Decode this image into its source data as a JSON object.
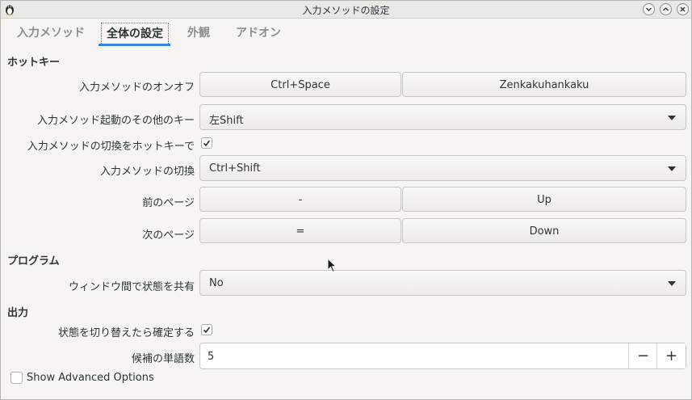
{
  "window": {
    "title": "入力メソッドの設定"
  },
  "tabs": [
    {
      "label": "入力メソッド"
    },
    {
      "label": "全体の設定"
    },
    {
      "label": "外観"
    },
    {
      "label": "アドオン"
    }
  ],
  "sections": {
    "hotkey": "ホットキー",
    "program": "プログラム",
    "output": "出力"
  },
  "hotkey": {
    "toggle_label": "入力メソッドのオンオフ",
    "toggle_keys": [
      "Ctrl+Space",
      "Zenkakuhankaku"
    ],
    "extra_label": "入力メソッド起動のその他のキー",
    "extra_value": "左Shift",
    "enum_hotkey_label": "入力メソッドの切換をホットキーで",
    "enum_hotkey_checked": true,
    "switch_label": "入力メソッドの切換",
    "switch_value": "Ctrl+Shift",
    "prev_page_label": "前のページ",
    "prev_page_keys": [
      "-",
      "Up"
    ],
    "next_page_label": "次のページ",
    "next_page_keys": [
      "=",
      "Down"
    ]
  },
  "program": {
    "share_label": "ウィンドウ間で状態を共有",
    "share_value": "No"
  },
  "output": {
    "commit_label": "状態を切り替えたら確定する",
    "commit_checked": true,
    "candidates_label": "候補の単語数",
    "candidates_value": "5",
    "minus": "−",
    "plus": "+"
  },
  "advanced": {
    "label": "Show Advanced Options",
    "checked": false
  }
}
